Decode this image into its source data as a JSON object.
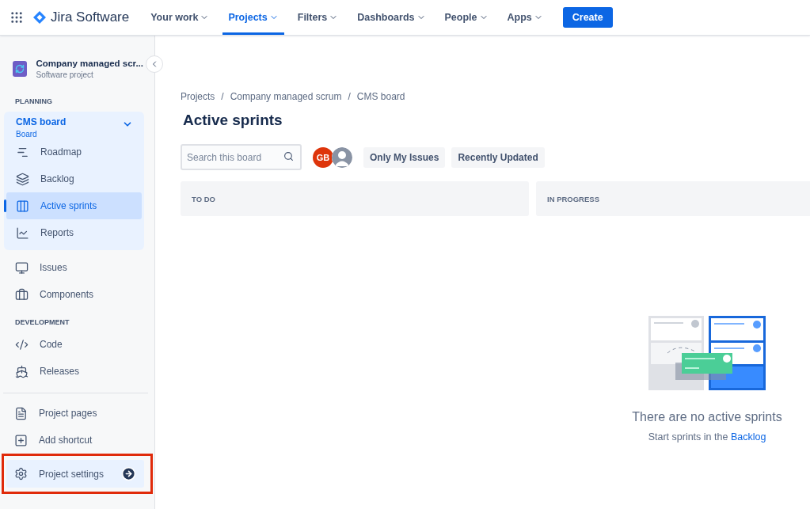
{
  "topbar": {
    "product": "Jira Software",
    "menus": [
      {
        "label": "Your work",
        "selected": false
      },
      {
        "label": "Projects",
        "selected": true
      },
      {
        "label": "Filters",
        "selected": false
      },
      {
        "label": "Dashboards",
        "selected": false
      },
      {
        "label": "People",
        "selected": false
      },
      {
        "label": "Apps",
        "selected": false
      }
    ],
    "create_button": "Create"
  },
  "sidebar": {
    "project": {
      "name": "Company managed scr...",
      "type": "Software project"
    },
    "planning_heading": "PLANNING",
    "board": {
      "name": "CMS board",
      "subtitle": "Board",
      "expanded": true,
      "items": [
        {
          "label": "Roadmap",
          "selected": false
        },
        {
          "label": "Backlog",
          "selected": false
        },
        {
          "label": "Active sprints",
          "selected": true
        },
        {
          "label": "Reports",
          "selected": false
        }
      ]
    },
    "planning_items": [
      {
        "label": "Issues",
        "selected": false
      },
      {
        "label": "Components",
        "selected": false
      }
    ],
    "development_heading": "DEVELOPMENT",
    "development_items": [
      {
        "label": "Code",
        "selected": false
      },
      {
        "label": "Releases",
        "selected": false
      }
    ],
    "footer_items": [
      {
        "label": "Project pages",
        "highlighted": false
      },
      {
        "label": "Add shortcut",
        "highlighted": false
      },
      {
        "label": "Project settings",
        "highlighted": true
      }
    ]
  },
  "main": {
    "breadcrumbs": [
      "Projects",
      "Company managed scrum",
      "CMS board"
    ],
    "breadcrumb_separator": "/",
    "title": "Active sprints",
    "search": {
      "placeholder": "Search this board"
    },
    "avatars": [
      {
        "kind": "initials",
        "text": "GB"
      },
      {
        "kind": "generic"
      }
    ],
    "filters": [
      {
        "label": "Only My Issues",
        "selected": false
      },
      {
        "label": "Recently Updated",
        "selected": false
      }
    ],
    "columns": [
      "TO DO",
      "IN PROGRESS"
    ],
    "empty_state": {
      "title": "There are no active sprints",
      "message": "Start sprints in the",
      "link": "Backlog"
    }
  }
}
